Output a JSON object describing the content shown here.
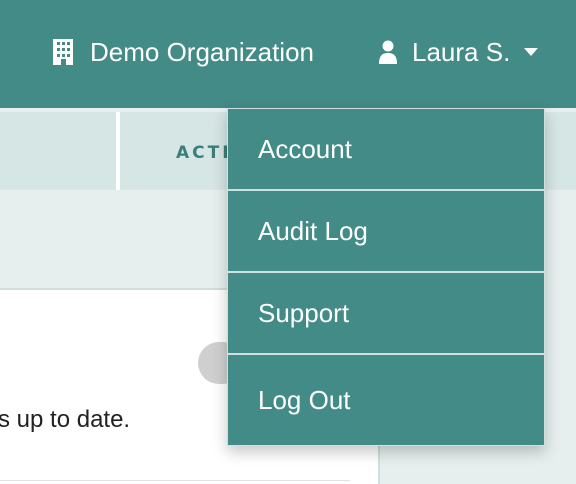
{
  "header": {
    "org_name": "Demo Organization",
    "org_icon": "building-icon",
    "user_name": "Laura S.",
    "user_icon": "user-icon",
    "caret_icon": "caret-down-icon"
  },
  "tabs": [
    {
      "label": ""
    },
    {
      "label": "ACTI"
    }
  ],
  "content": {
    "status_text": "s up to date."
  },
  "user_menu": {
    "items": [
      {
        "label": "Account"
      },
      {
        "label": "Audit Log"
      },
      {
        "label": "Support"
      },
      {
        "label": "Log Out"
      }
    ]
  },
  "colors": {
    "brand": "#428b87",
    "tab_bg": "#d6e6e4",
    "page_bg": "#e6efee"
  }
}
